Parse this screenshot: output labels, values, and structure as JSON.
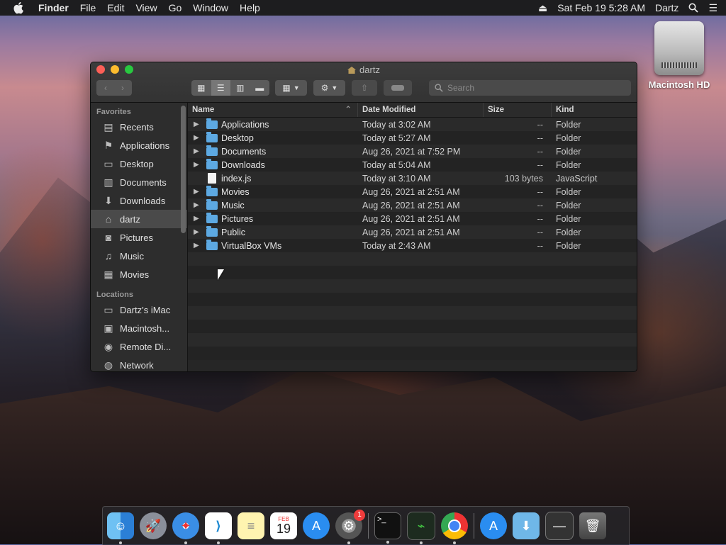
{
  "menubar": {
    "app": "Finder",
    "items": [
      "File",
      "Edit",
      "View",
      "Go",
      "Window",
      "Help"
    ],
    "clock": "Sat Feb 19  5:28 AM",
    "user": "Dartz"
  },
  "desktop": {
    "drive_label": "Macintosh HD"
  },
  "window": {
    "title": "dartz",
    "search_placeholder": "Search"
  },
  "sidebar": {
    "favorites_label": "Favorites",
    "favorites": [
      {
        "label": "Recents",
        "icon": "recents-icon"
      },
      {
        "label": "Applications",
        "icon": "applications-icon"
      },
      {
        "label": "Desktop",
        "icon": "desktop-icon"
      },
      {
        "label": "Documents",
        "icon": "documents-icon"
      },
      {
        "label": "Downloads",
        "icon": "downloads-icon"
      },
      {
        "label": "dartz",
        "icon": "home-icon",
        "selected": true
      },
      {
        "label": "Pictures",
        "icon": "camera-icon"
      },
      {
        "label": "Music",
        "icon": "music-icon"
      },
      {
        "label": "Movies",
        "icon": "film-icon"
      }
    ],
    "locations_label": "Locations",
    "locations": [
      {
        "label": "Dartz’s iMac",
        "icon": "imac-icon"
      },
      {
        "label": "Macintosh...",
        "icon": "disk-icon"
      },
      {
        "label": "Remote Di...",
        "icon": "remote-disc-icon"
      },
      {
        "label": "Network",
        "icon": "network-icon"
      }
    ]
  },
  "columns": {
    "name": "Name",
    "date": "Date Modified",
    "size": "Size",
    "kind": "Kind"
  },
  "files": [
    {
      "name": "Applications",
      "date": "Today at 3:02 AM",
      "size": "--",
      "kind": "Folder",
      "type": "folder"
    },
    {
      "name": "Desktop",
      "date": "Today at 5:27 AM",
      "size": "--",
      "kind": "Folder",
      "type": "folder"
    },
    {
      "name": "Documents",
      "date": "Aug 26, 2021 at 7:52 PM",
      "size": "--",
      "kind": "Folder",
      "type": "folder"
    },
    {
      "name": "Downloads",
      "date": "Today at 5:04 AM",
      "size": "--",
      "kind": "Folder",
      "type": "folder"
    },
    {
      "name": "index.js",
      "date": "Today at 3:10 AM",
      "size": "103 bytes",
      "kind": "JavaScript",
      "type": "file"
    },
    {
      "name": "Movies",
      "date": "Aug 26, 2021 at 2:51 AM",
      "size": "--",
      "kind": "Folder",
      "type": "folder"
    },
    {
      "name": "Music",
      "date": "Aug 26, 2021 at 2:51 AM",
      "size": "--",
      "kind": "Folder",
      "type": "folder"
    },
    {
      "name": "Pictures",
      "date": "Aug 26, 2021 at 2:51 AM",
      "size": "--",
      "kind": "Folder",
      "type": "folder"
    },
    {
      "name": "Public",
      "date": "Aug 26, 2021 at 2:51 AM",
      "size": "--",
      "kind": "Folder",
      "type": "folder"
    },
    {
      "name": "VirtualBox VMs",
      "date": "Today at 2:43 AM",
      "size": "--",
      "kind": "Folder",
      "type": "folder"
    }
  ],
  "dock": {
    "calendar_month": "FEB",
    "calendar_day": "19",
    "prefs_badge": "1"
  }
}
